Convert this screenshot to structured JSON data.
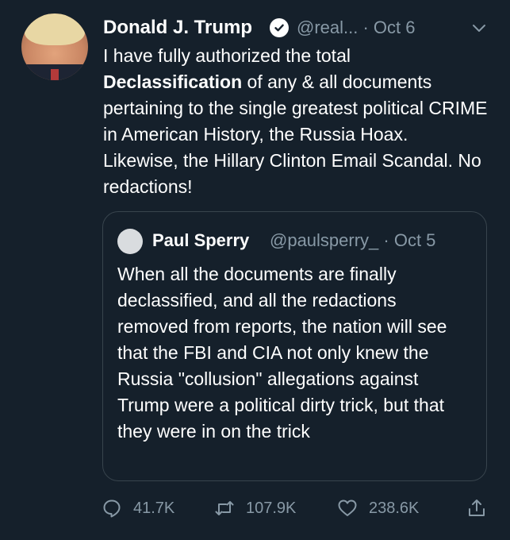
{
  "tweet": {
    "author_name": "Donald J. Trump",
    "handle_date": "@real... · Oct 6",
    "text_before": "I have fully authorized the total ",
    "text_bold": "Declassification",
    "text_after": " of any & all documents pertaining to the single greatest political CRIME in American History, the Russia Hoax. Likewise, the Hillary Clinton Email Scandal. No redactions!"
  },
  "quote": {
    "author_name": "Paul Sperry",
    "handle_date": "@paulsperry_ · Oct 5",
    "text": "When all the documents are finally declassified, and all the redactions removed from reports, the nation will see that the FBI and CIA not only knew the Russia \"collusion\" allegations against Trump were a political dirty trick, but that they were in on the trick"
  },
  "actions": {
    "replies": "41.7K",
    "retweets": "107.9K",
    "likes": "238.6K"
  },
  "icons": {
    "verified": "verified-badge-icon",
    "menu": "chevron-down-icon",
    "reply": "reply-icon",
    "retweet": "retweet-icon",
    "like": "heart-icon",
    "share": "share-icon"
  },
  "colors": {
    "background": "#15202b",
    "text": "#ffffff",
    "muted": "#8899a6",
    "border": "#38444d"
  }
}
